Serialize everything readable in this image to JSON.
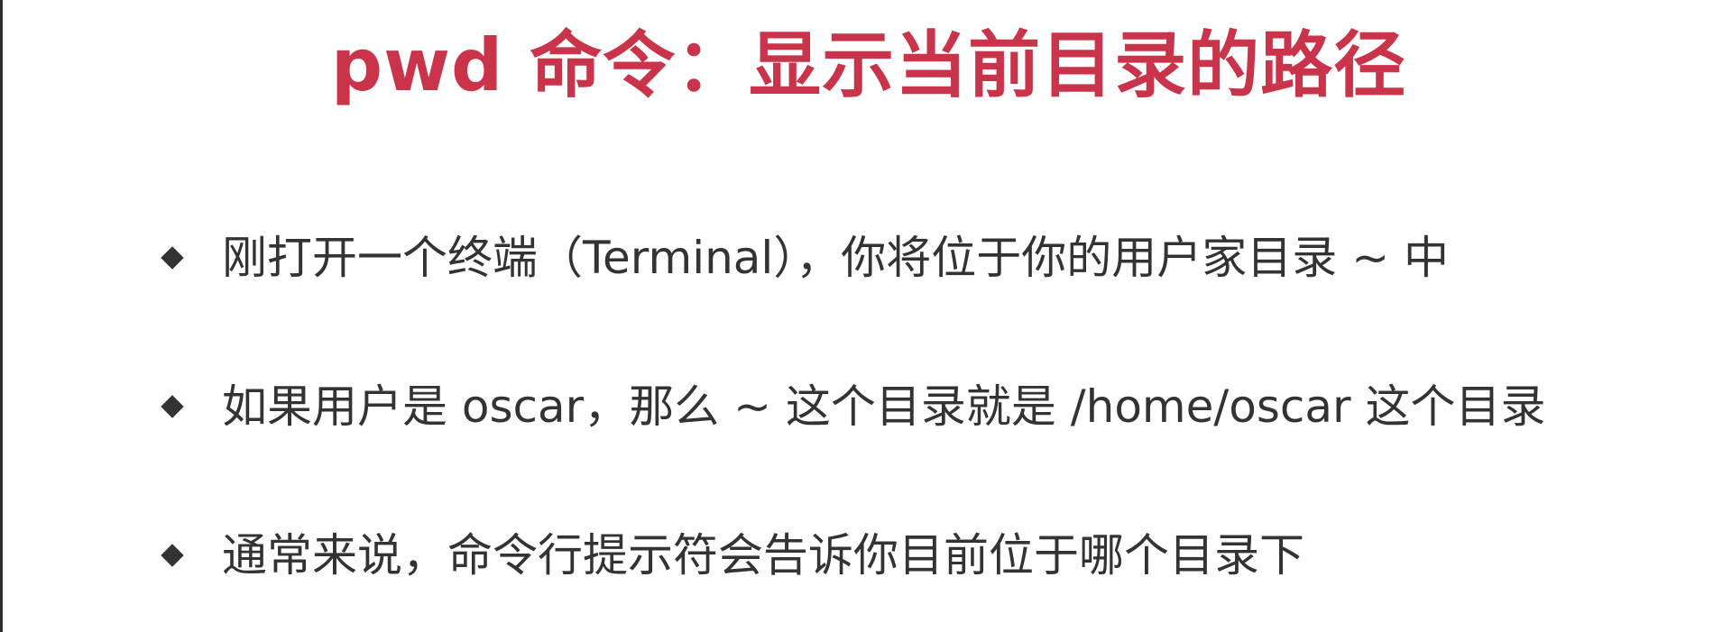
{
  "slide": {
    "title": "pwd 命令：显示当前目录的路径",
    "title_color": "#c9344a",
    "bullet_icon": "diamond-bullet-icon",
    "bullets": [
      {
        "text": "刚打开一个终端（Terminal），你将位于你的用户家目录 ~ 中"
      },
      {
        "text": "如果用户是 oscar，那么 ~ 这个目录就是 /home/oscar 这个目录"
      },
      {
        "text": "通常来说，命令行提示符会告诉你目前位于哪个目录下"
      }
    ]
  }
}
